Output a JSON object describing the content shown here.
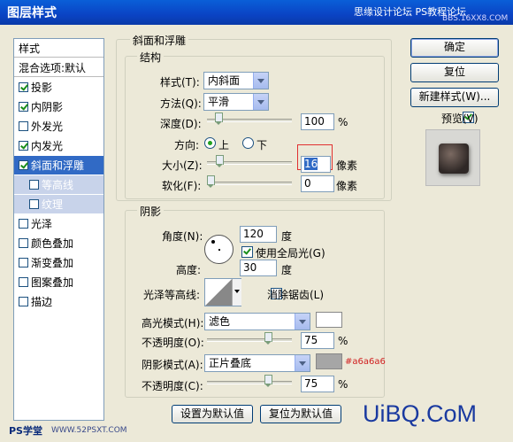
{
  "window": {
    "title": "图层样式",
    "watermark_top": "思缘设计论坛",
    "watermark_top2": "PS教程论坛",
    "watermark_sub": "BBS.16XX8.COM",
    "watermark_bottom_left": "PS学堂",
    "watermark_bottom_url": "WWW.52PSXT.COM",
    "watermark_bottom_right": "UiBQ.CoM"
  },
  "left_list": {
    "items": [
      {
        "label": "样式",
        "checked": null
      },
      {
        "label": "混合选项:默认",
        "checked": null
      },
      {
        "label": "投影",
        "checked": true
      },
      {
        "label": "内阴影",
        "checked": true
      },
      {
        "label": "外发光",
        "checked": false
      },
      {
        "label": "内发光",
        "checked": true
      },
      {
        "label": "斜面和浮雕",
        "checked": true
      },
      {
        "label": "等高线",
        "checked": false
      },
      {
        "label": "纹理",
        "checked": false
      },
      {
        "label": "光泽",
        "checked": false
      },
      {
        "label": "颜色叠加",
        "checked": false
      },
      {
        "label": "渐变叠加",
        "checked": false
      },
      {
        "label": "图案叠加",
        "checked": false
      },
      {
        "label": "描边",
        "checked": false
      }
    ]
  },
  "bevel": {
    "group_title": "斜面和浮雕",
    "structure_title": "结构",
    "style_label": "样式(T):",
    "style_value": "内斜面",
    "technique_label": "方法(Q):",
    "technique_value": "平滑",
    "depth_label": "深度(D):",
    "depth_value": "100",
    "depth_unit": "%",
    "depth_slider": 0.1,
    "direction_label": "方向:",
    "dir_up": "上",
    "dir_down": "下",
    "size_label": "大小(Z):",
    "size_value": "16",
    "size_unit": "像素",
    "size_slider": 0.12,
    "soften_label": "软化(F):",
    "soften_value": "0",
    "soften_unit": "像素",
    "soften_slider": 0.0
  },
  "shading": {
    "group_title": "阴影",
    "angle_label": "角度(N):",
    "angle_value": "120",
    "angle_unit": "度",
    "global_light_label": "使用全局光(G)",
    "altitude_label": "高度:",
    "altitude_value": "30",
    "altitude_unit": "度",
    "gloss_label": "光泽等高线:",
    "antialias_label": "消除锯齿(L)",
    "highlight_mode_label": "高光模式(H):",
    "highlight_mode_value": "滤色",
    "highlight_opacity_label": "不透明度(O):",
    "highlight_opacity_value": "75",
    "highlight_opacity_unit": "%",
    "highlight_opacity_slider": 0.75,
    "highlight_color": "#ffffff",
    "shadow_mode_label": "阴影模式(A):",
    "shadow_mode_value": "正片叠底",
    "shadow_color": "#a6a6a6",
    "shadow_color_text": "#a6a6a6",
    "shadow_opacity_label": "不透明度(C):",
    "shadow_opacity_value": "75",
    "shadow_opacity_unit": "%",
    "shadow_opacity_slider": 0.75
  },
  "bottom_buttons": {
    "set_default": "设置为默认值",
    "reset_default": "复位为默认值"
  },
  "right": {
    "ok": "确定",
    "reset": "复位",
    "new_style": "新建样式(W)...",
    "preview_label": "预览(V)"
  }
}
